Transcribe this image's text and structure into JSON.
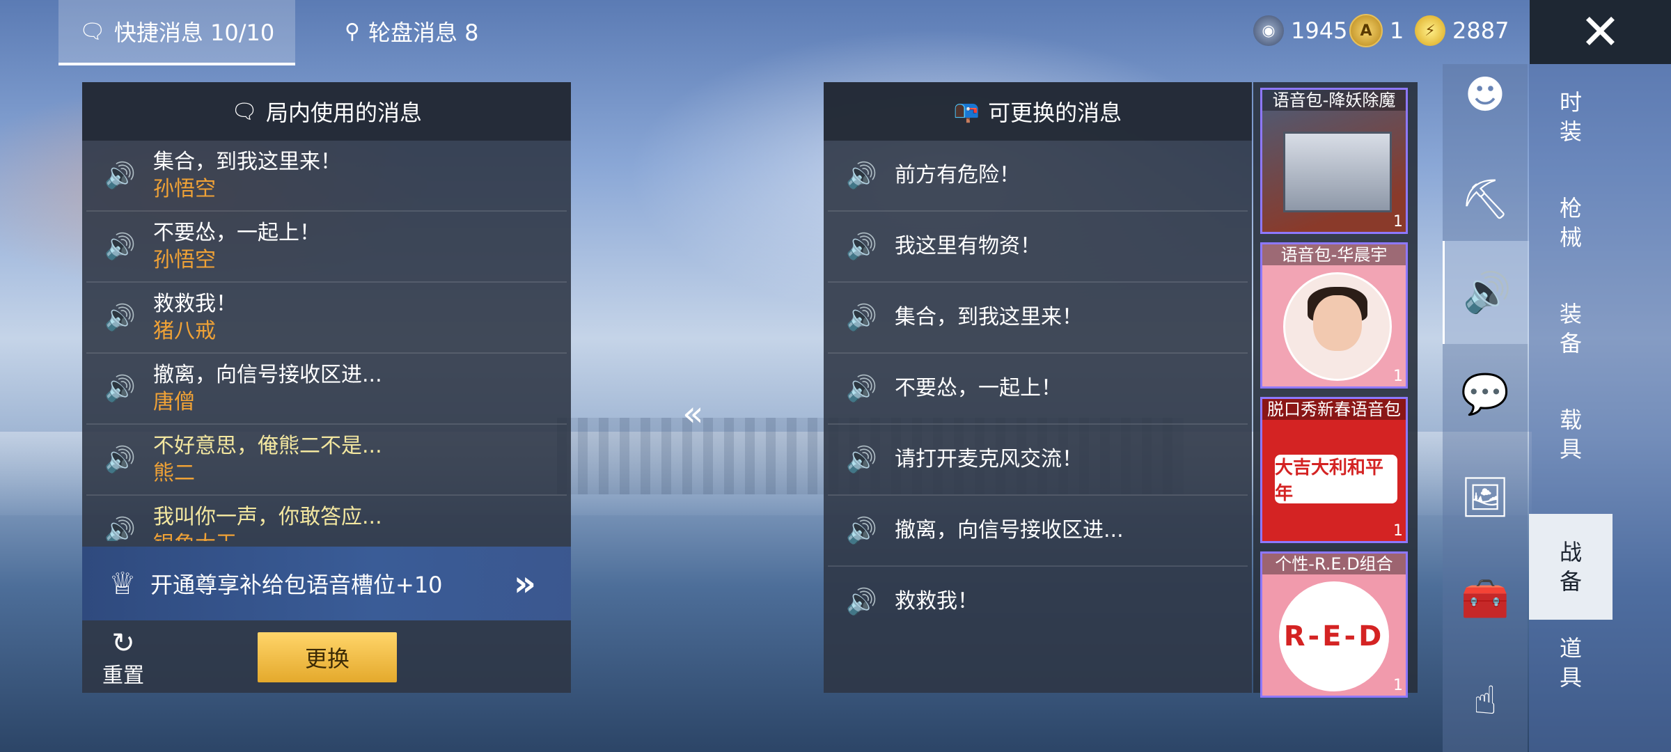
{
  "top_tabs": {
    "quick_messages": "快捷消息 10/10",
    "wheel_messages": "轮盘消息 8"
  },
  "currencies": [
    {
      "icon": "silver-coin-icon",
      "value": "1945"
    },
    {
      "icon": "gold-medal-icon",
      "value": "1"
    },
    {
      "icon": "gold-coin-icon",
      "value": "2887"
    }
  ],
  "left_panel": {
    "title": "局内使用的消息",
    "items": [
      {
        "text": "集合，到我这里来！",
        "source": "孙悟空"
      },
      {
        "text": "不要怂，一起上！",
        "source": "孙悟空"
      },
      {
        "text": "救救我！",
        "source": "猪八戒"
      },
      {
        "text": "撤离，向信号接收区进...",
        "source": "唐僧"
      },
      {
        "text": "不好意思，俺熊二不是...",
        "source": "熊二"
      },
      {
        "text": "我叫你一声，你敢答应...",
        "source": "银角大王"
      }
    ],
    "promo": "开通尊享补给包语音槽位+10",
    "reset": "重置",
    "swap": "更换"
  },
  "right_panel": {
    "title": "可更换的消息",
    "items": [
      "前方有危险！",
      "我这里有物资！",
      "集合，到我这里来！",
      "不要怂，一起上！",
      "请打开麦克风交流！",
      "撤离，向信号接收区进...",
      "救救我！"
    ]
  },
  "packs": [
    {
      "title": "语音包-降妖除魔",
      "count": "1"
    },
    {
      "title": "语音包-华晨宇",
      "count": "1"
    },
    {
      "title": "脱口秀新春语音包",
      "count": "1",
      "logo_text": "大吉大利和平年"
    },
    {
      "title": "个性-R.E.D组合",
      "count": "1",
      "logo_text": "R-E-D"
    }
  ],
  "categories": [
    "时装",
    "枪械",
    "装备",
    "载具",
    "战备",
    "道具"
  ],
  "active_category": "战备",
  "colors": {
    "source_text": "#f0a236",
    "swap_button": "#f2c14a",
    "pack_border": "#8e78ff"
  }
}
